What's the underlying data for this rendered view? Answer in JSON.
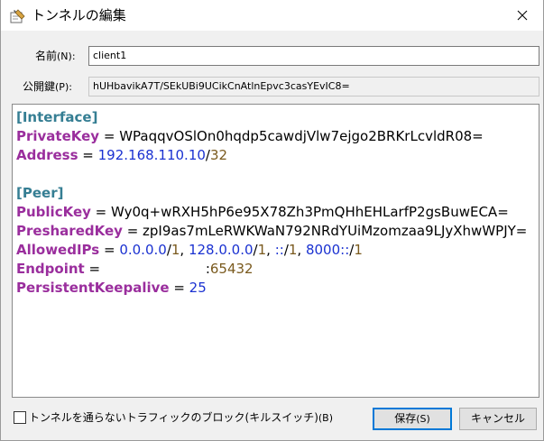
{
  "window": {
    "title": "トンネルの編集",
    "icon": "tunnel-edit-icon"
  },
  "form": {
    "name_label": "名前",
    "name_mnemonic": "(N):",
    "name_value": "client1",
    "pubkey_label": "公開鍵",
    "pubkey_mnemonic": "(P):",
    "pubkey_value": "hUHbavikA7T/SEkUBi9UCikCnAtlnEpvc3casYEvIC8="
  },
  "config": {
    "interface_header": "[Interface]",
    "private_key_name": "PrivateKey",
    "private_key_value": "WPaqqvOSlOn0hqdp5cawdjVlw7ejgo2BRKrLcvldR08=",
    "address_name": "Address",
    "address_ip": "192.168.110.10",
    "address_cidr": "32",
    "peer_header": "[Peer]",
    "public_key_name": "PublicKey",
    "public_key_value": "Wy0q+wRXH5hP6e95X78Zh3PmQHhEHLarfP2gsBuwECA=",
    "preshared_key_name": "PresharedKey",
    "preshared_key_value": "zpI9as7mLeRWKWaN792NRdYUiMzomzaa9LJyXhwWPJY=",
    "allowed_ips_name": "AllowedIPs",
    "allowed_ips": [
      {
        "ip": "0.0.0.0",
        "cidr": "1"
      },
      {
        "ip": "128.0.0.0",
        "cidr": "1"
      },
      {
        "ip": "::",
        "cidr": "1"
      },
      {
        "ip": "8000::",
        "cidr": "1"
      }
    ],
    "endpoint_name": "Endpoint",
    "endpoint_host": "",
    "endpoint_port": "65432",
    "keepalive_name": "PersistentKeepalive",
    "keepalive_value": "25"
  },
  "footer": {
    "block_checkbox_label": "トンネルを通らないトラフィックのブロック(キルスイッチ)",
    "block_checkbox_mnemonic": "(B)",
    "block_checkbox_checked": false,
    "save_label": "保存",
    "save_mnemonic": "(S)",
    "cancel_label": "キャンセル"
  },
  "colors": {
    "section": "#357e93",
    "key": "#9a2e9d",
    "ip": "#1b32d1",
    "number": "#7a5a1e",
    "focus": "#0078d7"
  }
}
